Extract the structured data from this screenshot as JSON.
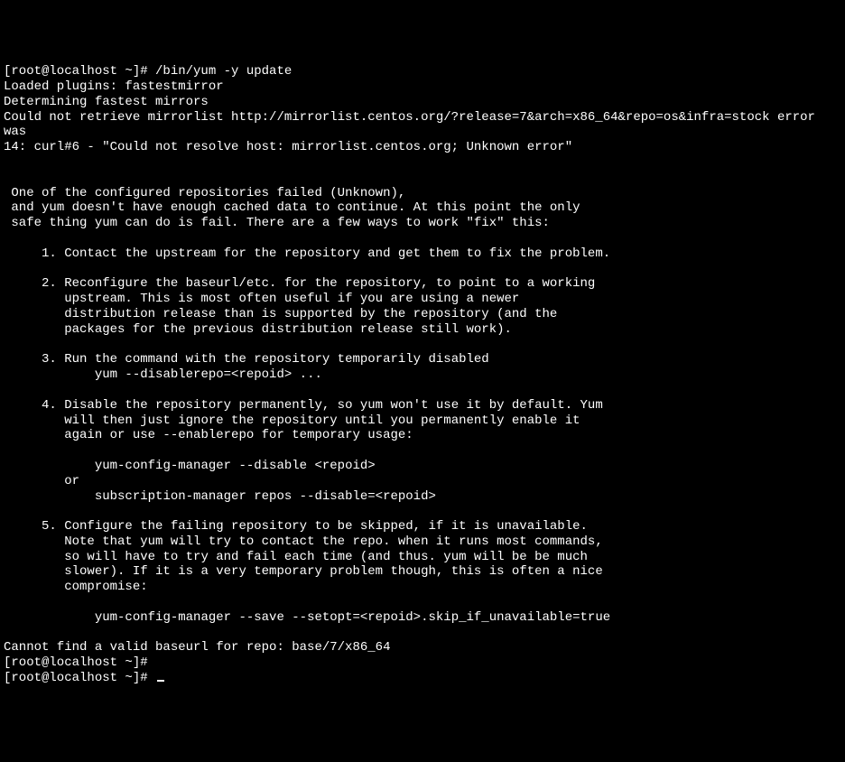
{
  "terminal": {
    "lines": [
      "[root@localhost ~]# /bin/yum -y update",
      "Loaded plugins: fastestmirror",
      "Determining fastest mirrors",
      "Could not retrieve mirrorlist http://mirrorlist.centos.org/?release=7&arch=x86_64&repo=os&infra=stock error was",
      "14: curl#6 - \"Could not resolve host: mirrorlist.centos.org; Unknown error\"",
      "",
      "",
      " One of the configured repositories failed (Unknown),",
      " and yum doesn't have enough cached data to continue. At this point the only",
      " safe thing yum can do is fail. There are a few ways to work \"fix\" this:",
      "",
      "     1. Contact the upstream for the repository and get them to fix the problem.",
      "",
      "     2. Reconfigure the baseurl/etc. for the repository, to point to a working",
      "        upstream. This is most often useful if you are using a newer",
      "        distribution release than is supported by the repository (and the",
      "        packages for the previous distribution release still work).",
      "",
      "     3. Run the command with the repository temporarily disabled",
      "            yum --disablerepo=<repoid> ...",
      "",
      "     4. Disable the repository permanently, so yum won't use it by default. Yum",
      "        will then just ignore the repository until you permanently enable it",
      "        again or use --enablerepo for temporary usage:",
      "",
      "            yum-config-manager --disable <repoid>",
      "        or",
      "            subscription-manager repos --disable=<repoid>",
      "",
      "     5. Configure the failing repository to be skipped, if it is unavailable.",
      "        Note that yum will try to contact the repo. when it runs most commands,",
      "        so will have to try and fail each time (and thus. yum will be be much",
      "        slower). If it is a very temporary problem though, this is often a nice",
      "        compromise:",
      "",
      "            yum-config-manager --save --setopt=<repoid>.skip_if_unavailable=true",
      "",
      "Cannot find a valid baseurl for repo: base/7/x86_64",
      "[root@localhost ~]#",
      "[root@localhost ~]# "
    ]
  }
}
